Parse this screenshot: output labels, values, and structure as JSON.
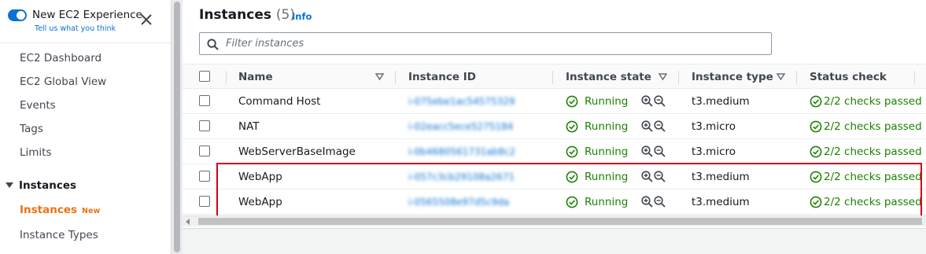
{
  "sidebar": {
    "toggle_title": "New EC2 Experience",
    "toggle_subtitle": "Tell us what you think",
    "items": [
      {
        "label": "EC2 Dashboard"
      },
      {
        "label": "EC2 Global View"
      },
      {
        "label": "Events"
      },
      {
        "label": "Tags"
      },
      {
        "label": "Limits"
      }
    ],
    "section": "Instances",
    "active_item": "Instances",
    "active_badge": "New",
    "sub_items": [
      {
        "label": "Instance Types"
      }
    ]
  },
  "header": {
    "title": "Instances",
    "count": "(5)",
    "info": "Info"
  },
  "search": {
    "placeholder": "Filter instances",
    "value": ""
  },
  "table": {
    "columns": [
      "Name",
      "Instance ID",
      "Instance state",
      "Instance type",
      "Status check"
    ],
    "rows": [
      {
        "name": "Command Host",
        "instance_id": "i-075ebe1ac54575329",
        "state": "Running",
        "type": "t3.medium",
        "status": "2/2 checks passed"
      },
      {
        "name": "NAT",
        "instance_id": "i-02eacc5ece5275184",
        "state": "Running",
        "type": "t3.micro",
        "status": "2/2 checks passed"
      },
      {
        "name": "WebServerBaseImage",
        "instance_id": "i-0b4680561731ab8c2",
        "state": "Running",
        "type": "t3.micro",
        "status": "2/2 checks passed"
      },
      {
        "name": "WebApp",
        "instance_id": "i-057c3cb29108a2671",
        "state": "Running",
        "type": "t3.medium",
        "status": "2/2 checks passed"
      },
      {
        "name": "WebApp",
        "instance_id": "i-0565508e97d5c9da",
        "state": "Running",
        "type": "t3.medium",
        "status": "2/2 checks passed"
      }
    ]
  },
  "colors": {
    "accent": "#0972d3",
    "active_nav": "#ec7211",
    "success": "#1d8102",
    "highlight_border": "#d0021b"
  },
  "icons": {
    "toggle": "toggle-switch-on",
    "close": "close-icon",
    "search": "search-icon",
    "sort": "sort-down-icon",
    "state": "check-circle-icon",
    "zoom_in": "zoom-in-icon",
    "zoom_out": "zoom-out-icon",
    "status": "check-circle-icon"
  }
}
